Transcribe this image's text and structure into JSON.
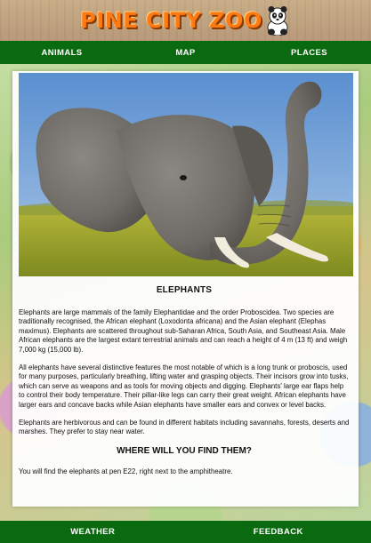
{
  "header": {
    "logo_text": "PINE CITY ZOO",
    "logo_icon": "panda-icon",
    "colors": {
      "logo_orange": "#ff7a12",
      "nav_green": "#0a6a0f"
    }
  },
  "nav": {
    "items": [
      {
        "label": "ANIMALS"
      },
      {
        "label": "MAP"
      },
      {
        "label": "PLACES"
      }
    ]
  },
  "main": {
    "photo_icon": "elephant-photo",
    "title": "ELEPHANTS",
    "paragraphs": [
      "Elephants are large mammals of the family Elephantidae and the order Proboscidea. Two species are traditionally recognised, the African elephant (Loxodonta africana) and the Asian elephant (Elephas maximus). Elephants are scattered throughout sub-Saharan Africa, South Asia, and Southeast Asia. Male African elephants are the largest extant terrestrial animals and can reach a height of 4 m (13 ft) and weigh 7,000 kg (15,000 lb).",
      "All elephants have several distinctive features the most notable of which is a long trunk or proboscis, used for many purposes, particularly breathing, lifting water and grasping objects. Their incisors grow into tusks, which can serve as weapons and as tools for moving objects and digging. Elephants' large ear flaps help to control their body temperature. Their pillar-like legs can carry their great weight. African elephants have larger ears and concave backs while Asian elephants have smaller ears and convex or level backs.",
      "Elephants are herbivorous and can be found in different habitats including savannahs, forests, deserts and marshes. They prefer to stay near water."
    ],
    "subtitle": "WHERE WILL YOU FIND THEM?",
    "location_text": "You will find the elephants at pen E22, right next to the amphitheatre."
  },
  "footer": {
    "items": [
      {
        "label": "WEATHER"
      },
      {
        "label": "FEEDBACK"
      }
    ]
  }
}
